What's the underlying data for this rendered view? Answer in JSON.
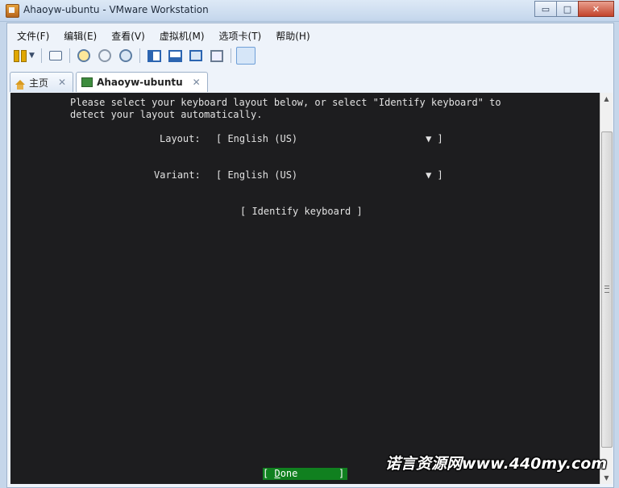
{
  "window": {
    "title": "Ahaoyw-ubuntu - VMware Workstation",
    "min_glyph": "▭",
    "max_glyph": "□",
    "close_glyph": "✕"
  },
  "menu": [
    "文件(F)",
    "编辑(E)",
    "查看(V)",
    "虚拟机(M)",
    "选项卡(T)",
    "帮助(H)"
  ],
  "toolbar": {
    "icons": [
      "pause-icon",
      "network-icon",
      "snapshot-icon",
      "revert-snapshot-icon",
      "snapshot-manager-icon",
      "console-view-icon",
      "thumbnail-view-icon",
      "fullscreen-icon",
      "unity-icon",
      "console-mode-icon"
    ]
  },
  "tabs": [
    {
      "label": "主页",
      "close": "✕"
    },
    {
      "label": "Ahaoyw-ubuntu",
      "close": "✕"
    }
  ],
  "console": {
    "intro_line1": "Please select your keyboard layout below, or select \"Identify keyboard\" to",
    "intro_line2": "detect your layout automatically.",
    "layout_label": "Layout:",
    "layout_value": "[ English (US)                      ▼ ]",
    "variant_label": "Variant:",
    "variant_value": "[ English (US)                      ▼ ]",
    "identify_button": "[ Identify keyboard ]",
    "done_open": "[ ",
    "done_underlined": "D",
    "done_rest": "one",
    "done_close": "       ]",
    "bg_color": "#1d1d1f",
    "done_color": "#10801f"
  },
  "scrollbar": {
    "up": "▲",
    "down": "▼"
  },
  "watermark": "诺言资源网www.440my.com"
}
